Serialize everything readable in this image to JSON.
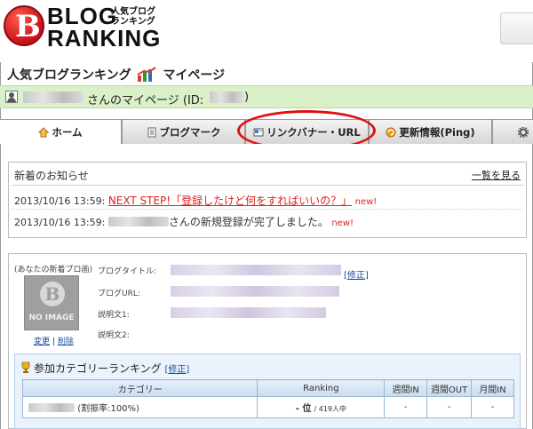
{
  "header": {
    "logo_mark": "B",
    "logo_line1": "BLOG",
    "logo_line2": "RANKING",
    "logo_sub": "人気ブログランキング"
  },
  "mypage": {
    "title_left": "人気ブログランキング",
    "title_right": "マイページ"
  },
  "userbar": {
    "suffix": "さんのマイページ (ID:",
    "id_close": ")"
  },
  "tabs": [
    {
      "label": "ホーム",
      "icon": "home-icon",
      "active": true
    },
    {
      "label": "ブログマーク",
      "icon": "document-icon",
      "active": false
    },
    {
      "label": "リンクバナー・URL",
      "icon": "banner-icon",
      "active": false
    },
    {
      "label": "更新情報(Ping)",
      "icon": "refresh-icon",
      "active": false
    }
  ],
  "news": {
    "title": "新着のお知らせ",
    "more_link": "一覧を見る",
    "items": [
      {
        "timestamp": "2013/10/16 13:59:",
        "link_text": "NEXT STEP!「登録したけど何をすればいいの？」",
        "badge": "new!"
      },
      {
        "timestamp": "2013/10/16 13:59:",
        "text": "さんの新規登録が完了しました。",
        "badge": "new!"
      }
    ]
  },
  "profile": {
    "caption": "(あなたの新着プロ画)",
    "noimage": "NO IMAGE",
    "change": "変更",
    "delete": "削除",
    "separator": "|",
    "labels": {
      "title": "ブログタイトル:",
      "url": "ブログURL:",
      "desc1": "説明文1:",
      "desc2": "説明文2:"
    },
    "edit": "修正"
  },
  "category": {
    "title": "参加カテゴリーランキング",
    "edit": "修正",
    "headers": [
      "カテゴリー",
      "Ranking",
      "週間IN",
      "週間OUT",
      "月間IN"
    ],
    "rows": [
      {
        "category_suffix": "(割振率:100%)",
        "rank": "- 位",
        "rank_total": "/ 419人中",
        "weekly_in": "-",
        "weekly_out": "-",
        "monthly_in": "-"
      }
    ]
  },
  "colors": {
    "accent_red": "#e0201a",
    "userbar_green": "#d9f0c8",
    "link_blue": "#1a4fa0"
  }
}
